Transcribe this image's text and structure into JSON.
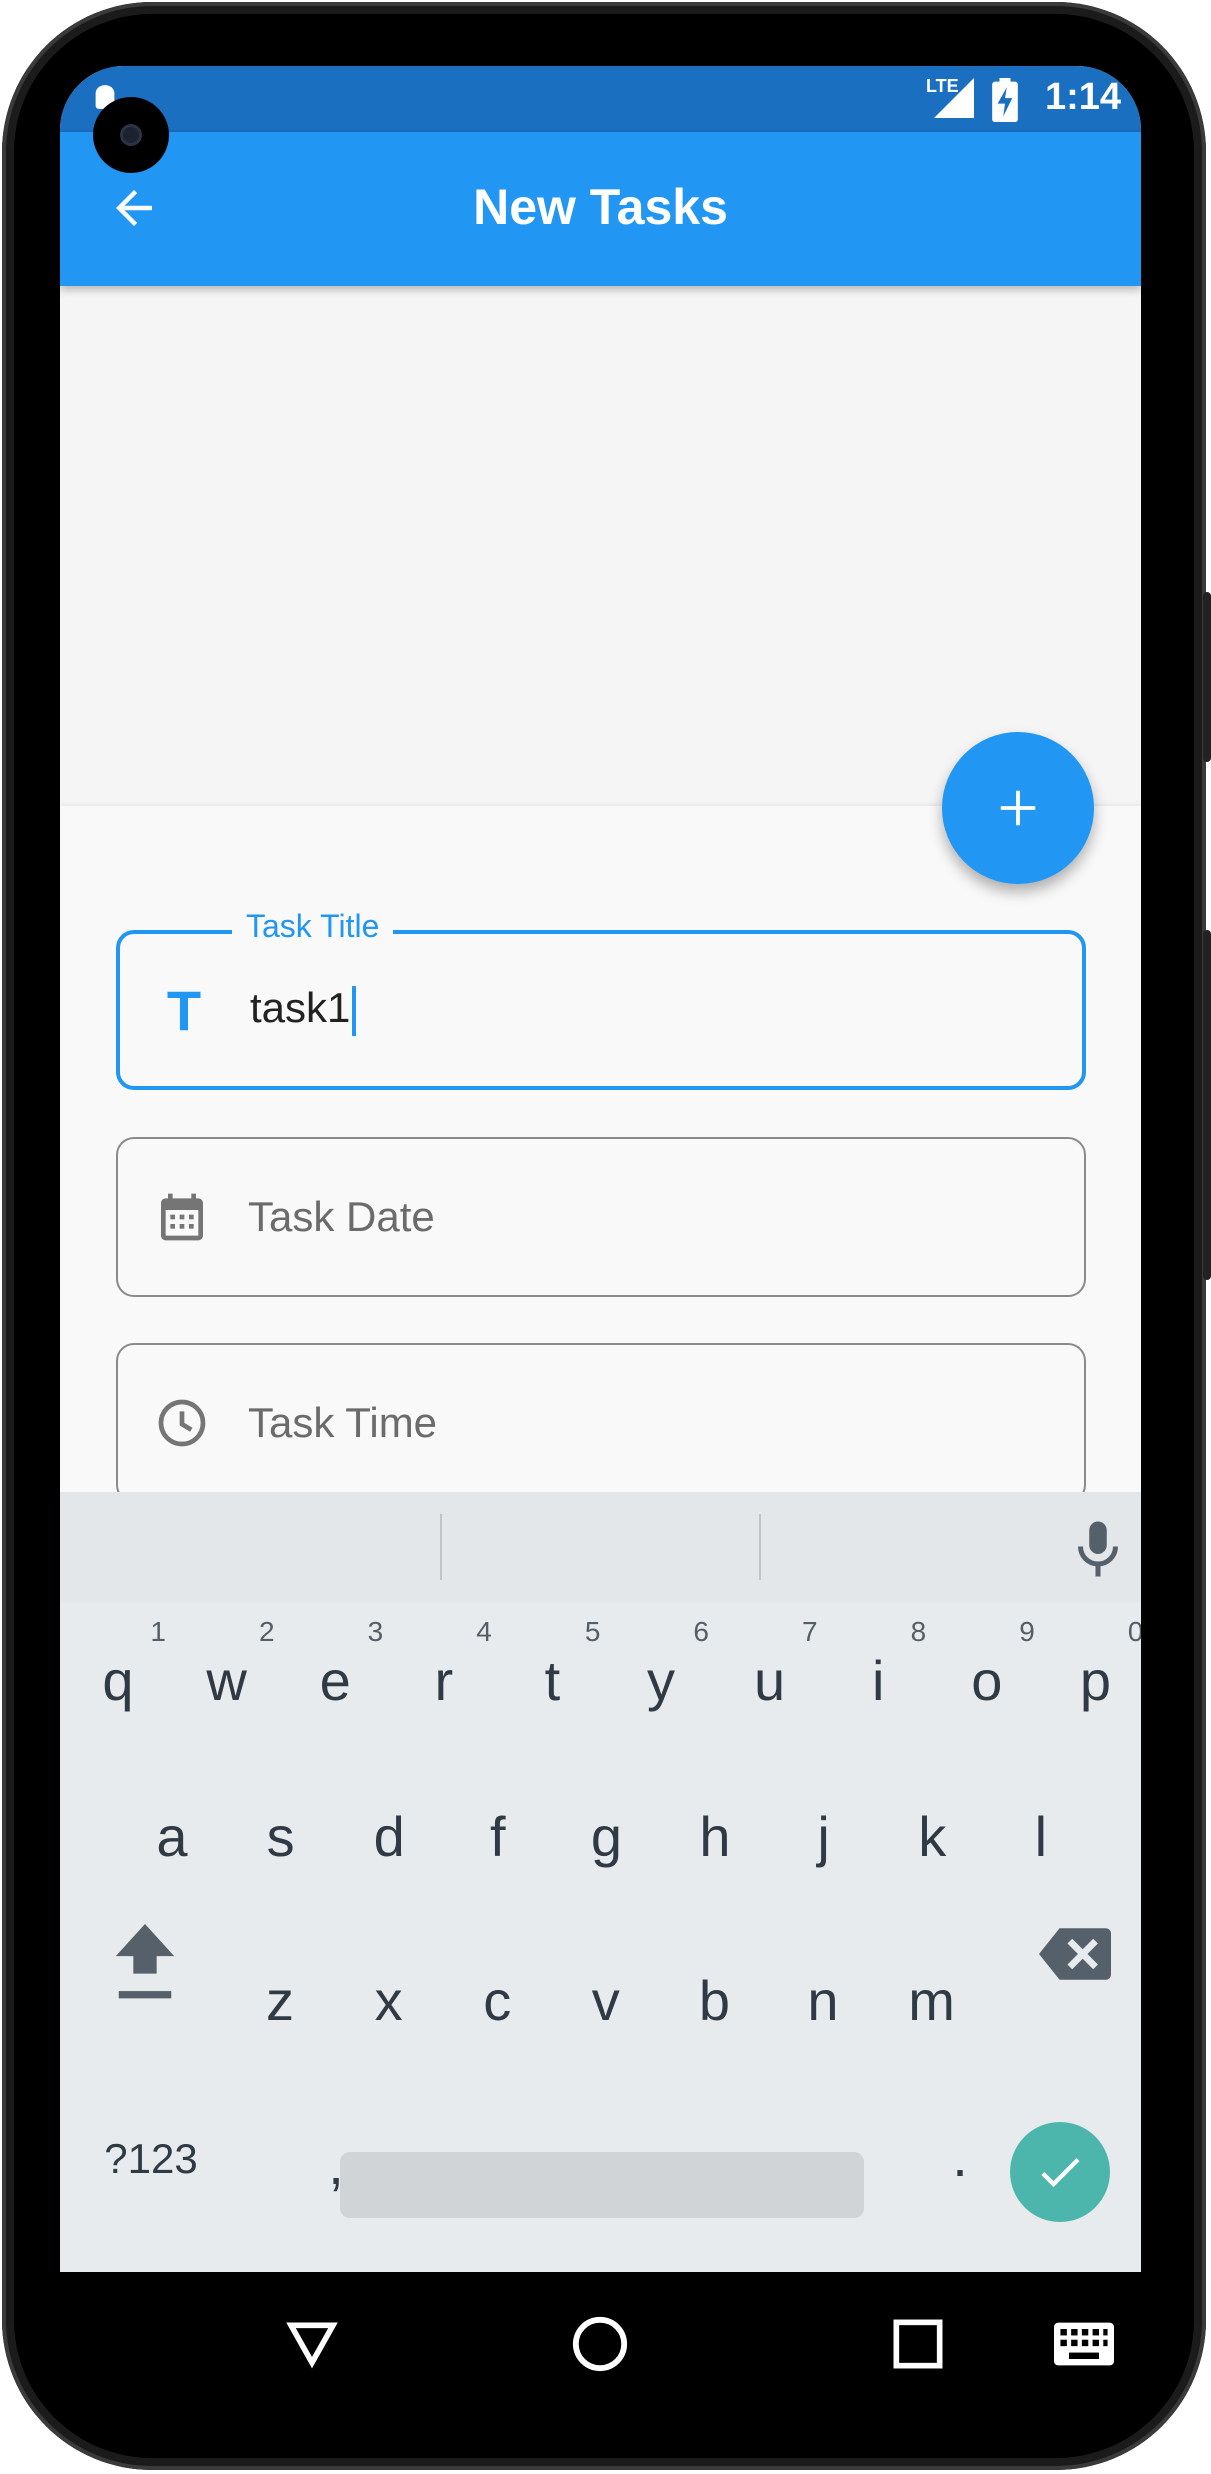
{
  "status_bar": {
    "time": "1:14",
    "network": "LTE"
  },
  "app_bar": {
    "title": "New Tasks"
  },
  "form": {
    "title_field": {
      "label": "Task Title",
      "value": "task1"
    },
    "date_field": {
      "placeholder": "Task Date"
    },
    "time_field": {
      "placeholder": "Task Time"
    }
  },
  "keyboard": {
    "row1": [
      {
        "key": "q",
        "hint": "1"
      },
      {
        "key": "w",
        "hint": "2"
      },
      {
        "key": "e",
        "hint": "3"
      },
      {
        "key": "r",
        "hint": "4"
      },
      {
        "key": "t",
        "hint": "5"
      },
      {
        "key": "y",
        "hint": "6"
      },
      {
        "key": "u",
        "hint": "7"
      },
      {
        "key": "i",
        "hint": "8"
      },
      {
        "key": "o",
        "hint": "9"
      },
      {
        "key": "p",
        "hint": "0"
      }
    ],
    "row2": [
      "a",
      "s",
      "d",
      "f",
      "g",
      "h",
      "j",
      "k",
      "l"
    ],
    "row3": [
      "z",
      "x",
      "c",
      "v",
      "b",
      "n",
      "m"
    ],
    "symbols_key": "?123",
    "comma_key": ",",
    "period_key": "."
  },
  "colors": {
    "primary": "#2196f3",
    "status_bar": "#1a6fc0",
    "enter_key": "#4db6ac"
  },
  "icons": {
    "back": "arrow-left-icon",
    "fab": "plus-icon",
    "title": "text-t-icon",
    "date": "calendar-icon",
    "time": "clock-icon",
    "mic": "microphone-icon",
    "shift": "shift-icon",
    "backspace": "backspace-icon",
    "enter": "check-icon"
  }
}
